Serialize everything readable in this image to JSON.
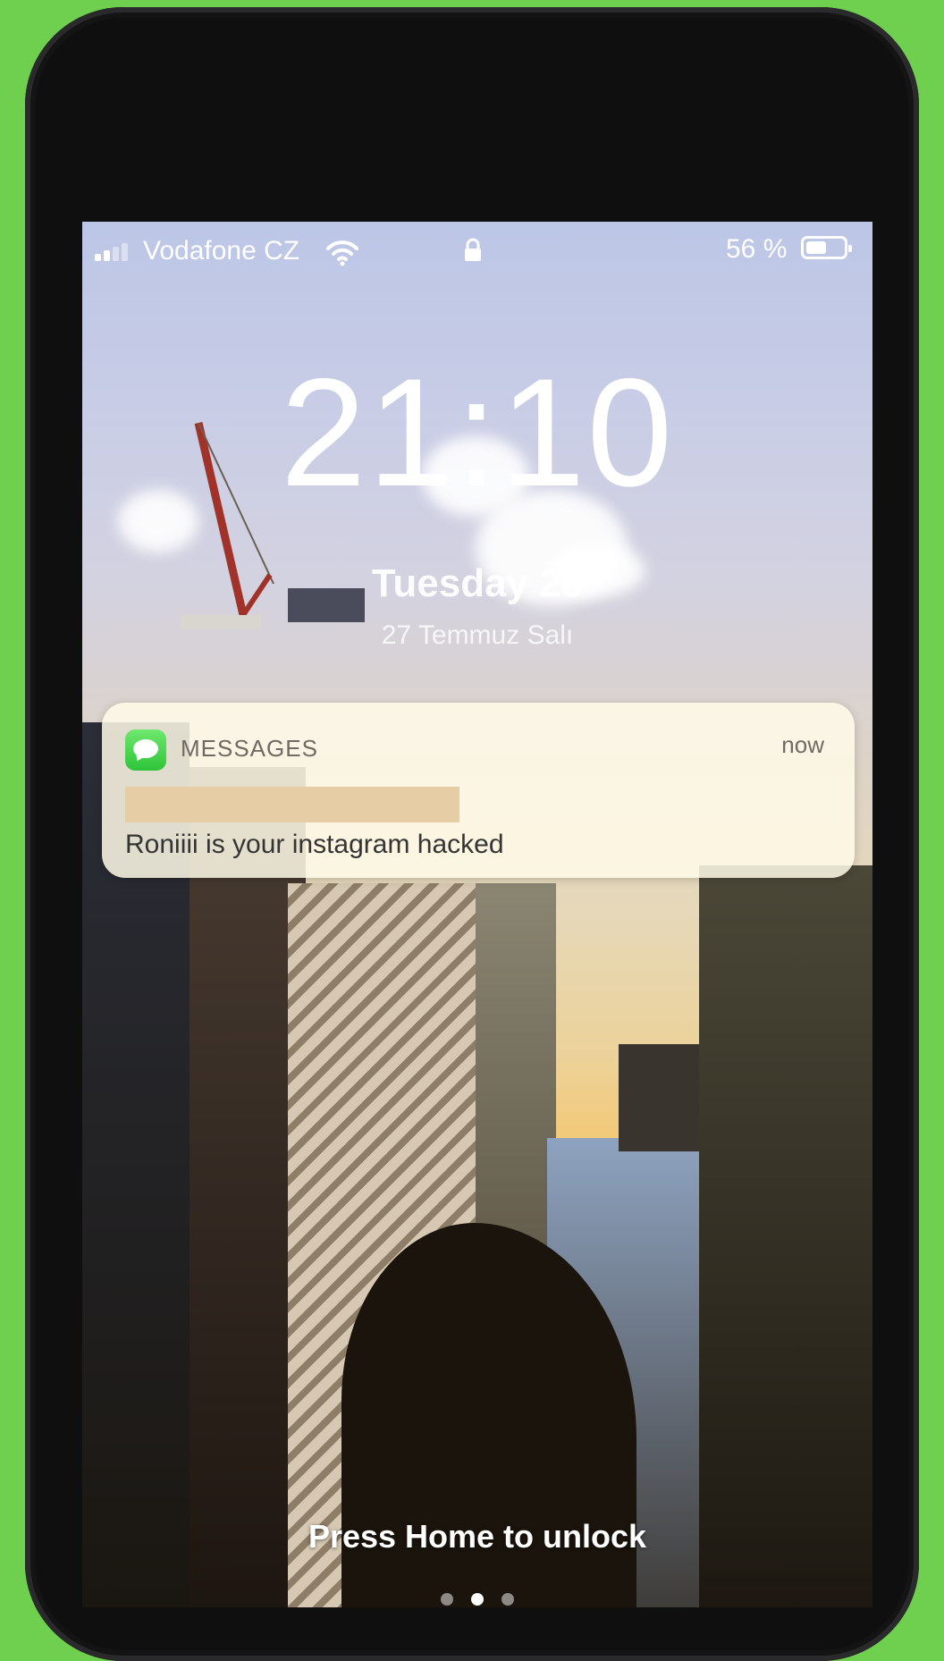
{
  "status_bar": {
    "carrier": "Vodafone CZ",
    "battery_percent": "56 %",
    "battery_level": 0.56,
    "icons": [
      "signal-icon",
      "wifi-icon",
      "lock-icon",
      "battery-icon"
    ]
  },
  "lock_screen": {
    "time": "21:10",
    "date": "Tuesday 26",
    "subdate": "27 Temmuz Salı"
  },
  "notification": {
    "app_name": "MESSAGES",
    "time": "now",
    "message": "Roniiii is your instagram hacked",
    "app_icon": "messages-icon"
  },
  "footer": {
    "unlock_hint": "Press Home to unlock"
  },
  "colors": {
    "background": "#6fcf4f",
    "phone_bezel": "#0f0f10",
    "notification_bg": "#fffae8",
    "messages_green": "#34c759",
    "redaction": "#e6cda6"
  }
}
